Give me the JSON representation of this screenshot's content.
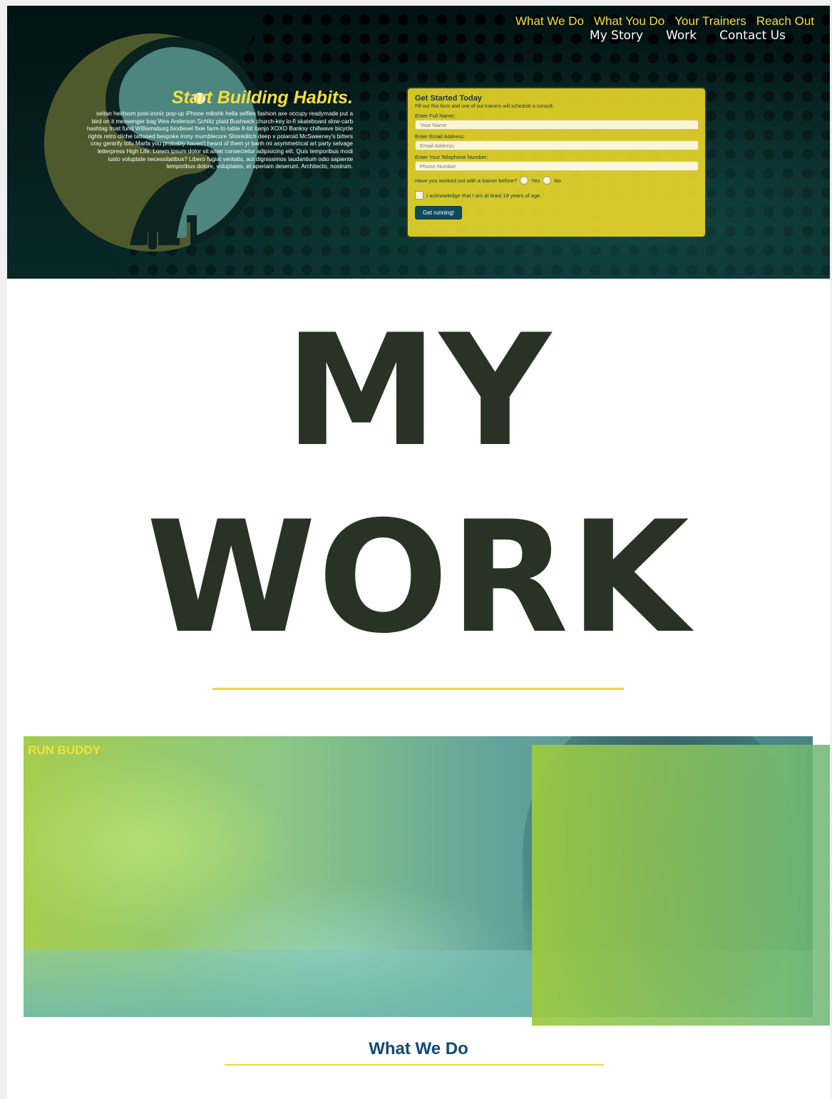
{
  "nav": {
    "items": [
      "My Story",
      "Work",
      "Contact Us"
    ]
  },
  "title": {
    "line1": "MY",
    "line2": "WORK"
  },
  "colors": {
    "accent": "#f2d24f",
    "title": "#293325",
    "header_bg": "#04191a",
    "logo_olive": "#4f5a2c",
    "logo_teal": "#4d857f"
  },
  "project": {
    "brand": "RUN BUDDY",
    "nav": [
      "What We Do",
      "What You Do",
      "Your Trainers",
      "Reach Out"
    ],
    "hero_title": "Start Building Habits.",
    "hero_text": "seitan heirloom post-ironic pop-up iPhone mlkshk hella selfies fashion axe occupy readymade put a bird on it messenger bag Wes Anderson Schlitz plaid Bushwick church-key lo-fi skateboard slow-carb hashtag trust fund Williamsburg biodiesel fixie farm-to-table 8-bit banjo XOXO Banksy chillwave bicycle rights retro cliche tattooed bespoke irony mumblecore Shoreditch deep v polaroid McSweeney's bitters cray gentrify tofu Marfa you probably haven't heard of them yr banh mi asymmetrical art party selvage letterpress High Life. Lorem ipsum dolor sit amet consectetur adipisicing elit. Quis temporibus modi iusto voluptate necessitatibus? Libero fugiat veritatis, aut dignissimos laudantium odio sapiente temporibus dolore, voluptates, et aperiam deserunt. Architecto, nostrum.",
    "form": {
      "title": "Get Started Today",
      "subtitle": "Fill out this form and one of out trainers will schedule a consult.",
      "name_label": "Enter Full Name:",
      "name_placeholder": "Your Name",
      "email_label": "Enter Email Address:",
      "email_placeholder": "Email Address",
      "phone_label": "Enter Your Telephone Number:",
      "phone_placeholder": "Phone Number",
      "trainer_question": "Have you worked out with a trainer before?",
      "yes": "Yes",
      "no": "No",
      "age_ack": "I acknowledge that I am at least 18 years of age.",
      "submit": "Get running!"
    },
    "section_title": "What We Do"
  }
}
